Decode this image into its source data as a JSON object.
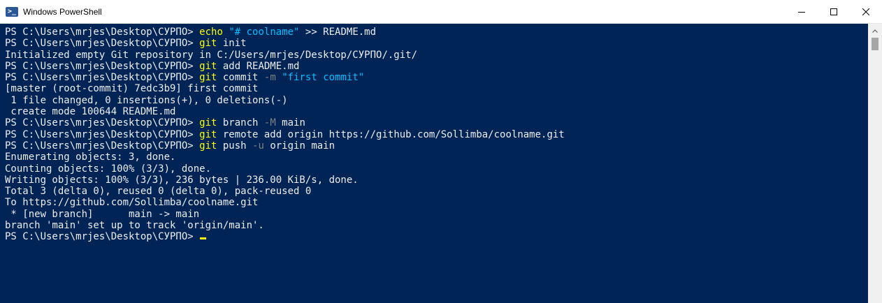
{
  "window": {
    "title": "Windows PowerShell",
    "icons": {
      "app": "powershell-icon",
      "minimize": "minimize-icon",
      "maximize": "maximize-icon",
      "close": "close-icon"
    }
  },
  "colors": {
    "background": "#012456",
    "text": "#eeedf0",
    "command": "#ffff00",
    "parameter": "#808080",
    "string": "#00bfff"
  },
  "console": {
    "lines": [
      [
        {
          "t": "PS C:\\Users\\mrjes\\Desktop\\СУРПО> ",
          "c": "text"
        },
        {
          "t": "echo",
          "c": "cmd"
        },
        {
          "t": " ",
          "c": "text"
        },
        {
          "t": "\"# coolname\"",
          "c": "str"
        },
        {
          "t": " >> README.md",
          "c": "text"
        }
      ],
      [
        {
          "t": "PS C:\\Users\\mrjes\\Desktop\\СУРПО> ",
          "c": "text"
        },
        {
          "t": "git",
          "c": "cmd"
        },
        {
          "t": " init",
          "c": "text"
        }
      ],
      [
        {
          "t": "Initialized empty Git repository in C:/Users/mrjes/Desktop/СУРПО/.git/",
          "c": "text"
        }
      ],
      [
        {
          "t": "PS C:\\Users\\mrjes\\Desktop\\СУРПО> ",
          "c": "text"
        },
        {
          "t": "git",
          "c": "cmd"
        },
        {
          "t": " add README.md",
          "c": "text"
        }
      ],
      [
        {
          "t": "PS C:\\Users\\mrjes\\Desktop\\СУРПО> ",
          "c": "text"
        },
        {
          "t": "git",
          "c": "cmd"
        },
        {
          "t": " commit ",
          "c": "text"
        },
        {
          "t": "-m",
          "c": "param"
        },
        {
          "t": " ",
          "c": "text"
        },
        {
          "t": "\"first commit\"",
          "c": "str"
        }
      ],
      [
        {
          "t": "[master (root-commit) 7edc3b9] first commit",
          "c": "text"
        }
      ],
      [
        {
          "t": " 1 file changed, 0 insertions(+), 0 deletions(-)",
          "c": "text"
        }
      ],
      [
        {
          "t": " create mode 100644 README.md",
          "c": "text"
        }
      ],
      [
        {
          "t": "PS C:\\Users\\mrjes\\Desktop\\СУРПО> ",
          "c": "text"
        },
        {
          "t": "git",
          "c": "cmd"
        },
        {
          "t": " branch ",
          "c": "text"
        },
        {
          "t": "-M",
          "c": "param"
        },
        {
          "t": " main",
          "c": "text"
        }
      ],
      [
        {
          "t": "PS C:\\Users\\mrjes\\Desktop\\СУРПО> ",
          "c": "text"
        },
        {
          "t": "git",
          "c": "cmd"
        },
        {
          "t": " remote add origin https://github.com/Sollimba/coolname.git",
          "c": "text"
        }
      ],
      [
        {
          "t": "PS C:\\Users\\mrjes\\Desktop\\СУРПО> ",
          "c": "text"
        },
        {
          "t": "git",
          "c": "cmd"
        },
        {
          "t": " push ",
          "c": "text"
        },
        {
          "t": "-u",
          "c": "param"
        },
        {
          "t": " origin main",
          "c": "text"
        }
      ],
      [
        {
          "t": "Enumerating objects: 3, done.",
          "c": "text"
        }
      ],
      [
        {
          "t": "Counting objects: 100% (3/3), done.",
          "c": "text"
        }
      ],
      [
        {
          "t": "Writing objects: 100% (3/3), 236 bytes | 236.00 KiB/s, done.",
          "c": "text"
        }
      ],
      [
        {
          "t": "Total 3 (delta 0), reused 0 (delta 0), pack-reused 0",
          "c": "text"
        }
      ],
      [
        {
          "t": "To https://github.com/Sollimba/coolname.git",
          "c": "text"
        }
      ],
      [
        {
          "t": " * [new branch]      main -> main",
          "c": "text"
        }
      ],
      [
        {
          "t": "branch 'main' set up to track 'origin/main'.",
          "c": "text"
        }
      ],
      [
        {
          "t": "PS C:\\Users\\mrjes\\Desktop\\СУРПО> ",
          "c": "text"
        }
      ]
    ]
  }
}
